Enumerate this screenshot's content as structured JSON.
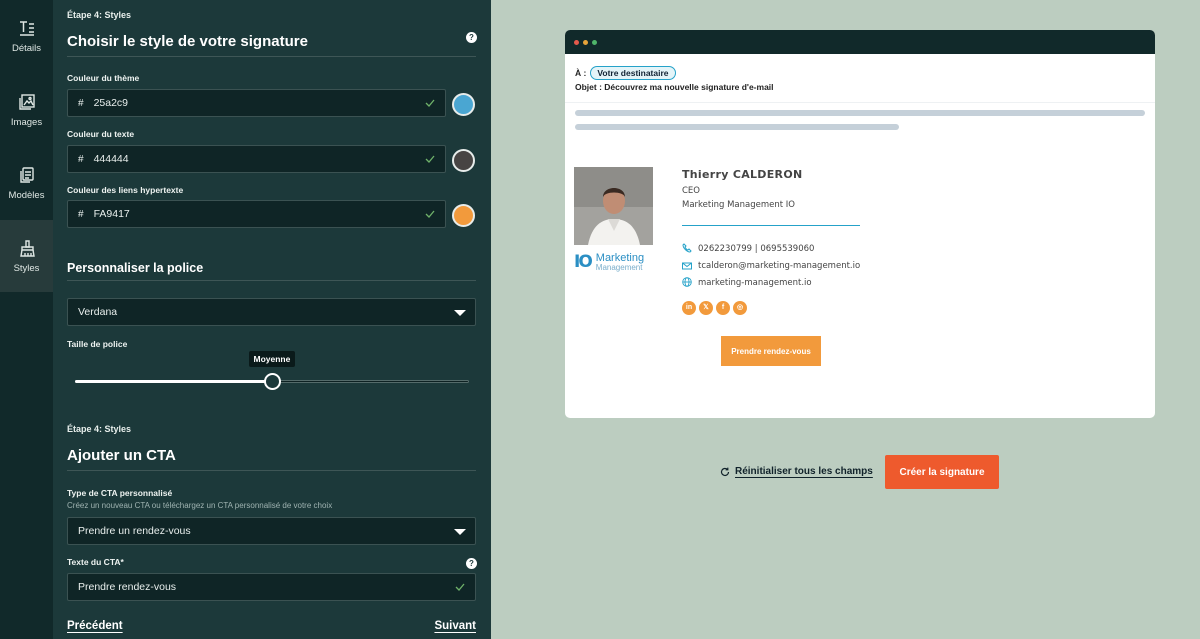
{
  "rail": {
    "items": [
      {
        "label": "Détails",
        "icon": "text-icon"
      },
      {
        "label": "Images",
        "icon": "image-icon"
      },
      {
        "label": "Modèles",
        "icon": "copy-icon"
      },
      {
        "label": "Styles",
        "icon": "brush-icon",
        "active": true
      }
    ]
  },
  "styles": {
    "step_label": "Étape 4: Styles",
    "title": "Choisir le style de votre signature",
    "help": "?",
    "theme_color": {
      "label": "Couleur du thème",
      "hash": "#",
      "value": "25a2c9",
      "hex": "#4aa6d2"
    },
    "text_color": {
      "label": "Couleur du texte",
      "hash": "#",
      "value": "444444",
      "hex": "#474443"
    },
    "link_color": {
      "label": "Couleur des liens hypertexte",
      "hash": "#",
      "value": "FA9417",
      "hex": "#f29a3c"
    },
    "font_section": "Personnaliser la police",
    "font_value": "Verdana",
    "font_size_label": "Taille de police",
    "font_size_tooltip": "Moyenne",
    "font_size_level": 0.5
  },
  "cta_section": {
    "step_label": "Étape 4: Styles",
    "title": "Ajouter un CTA",
    "type_label": "Type de CTA personnalisé",
    "type_sub": "Créez un nouveau CTA ou téléchargez un CTA personnalisé de votre choix",
    "type_value": "Prendre un rendez-vous",
    "text_label": "Texte du CTA*",
    "help": "?",
    "text_value": "Prendre rendez-vous"
  },
  "nav": {
    "prev": "Précédent",
    "next": "Suivant"
  },
  "preview": {
    "to_label": "À :",
    "to_chip": "Votre destinataire",
    "subject": "Objet : Découvrez ma nouvelle signature d'e-mail",
    "name": "Thierry CALDERON",
    "role": "CEO",
    "company": "Marketing Management IO",
    "phones": "0262230799  |  0695539060",
    "email": "tcalderon@marketing-management.io",
    "website": "marketing-management.io",
    "logo_mark": "IO",
    "logo_line1": "Marketing",
    "logo_line2": "Management",
    "socials": [
      "in",
      "𝕏",
      "f",
      "◎"
    ],
    "cta": "Prendre rendez-vous"
  },
  "actions": {
    "reset": "Réinitialiser tous les champs",
    "create": "Créer la signature"
  },
  "colors": {
    "accent": "#ee5a2d",
    "panel": "#1c393a",
    "rail": "#11292a",
    "background": "#bccdc0"
  }
}
